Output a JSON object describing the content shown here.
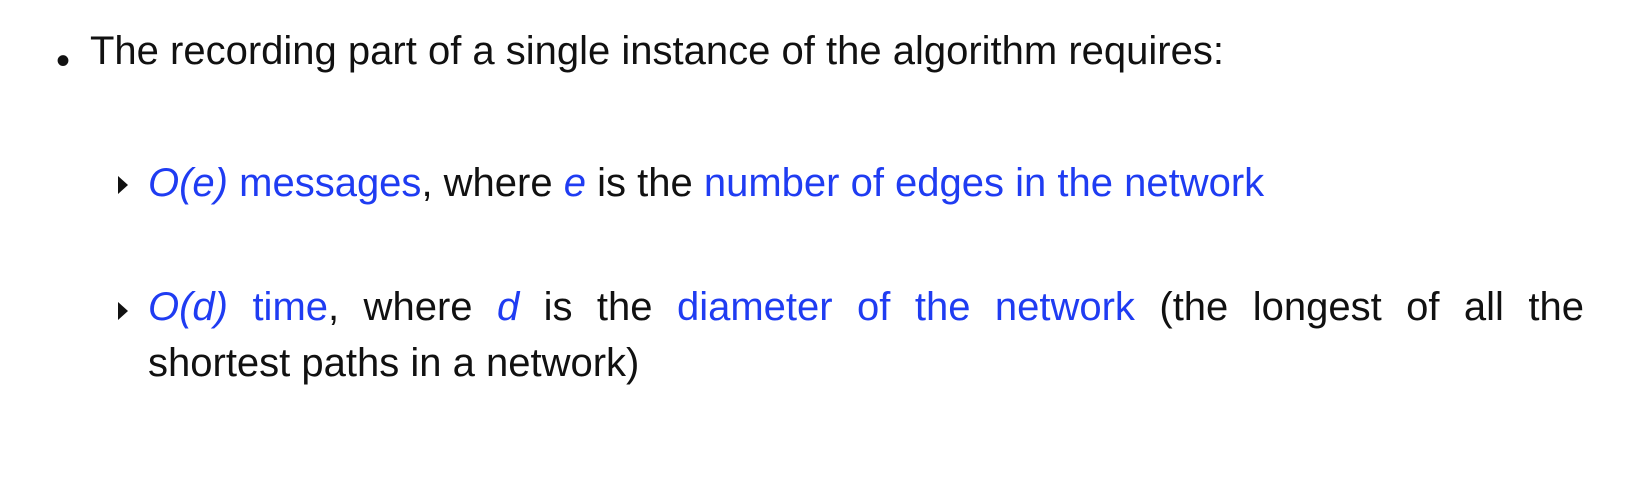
{
  "main_bullet": {
    "marker": "•",
    "text": "The recording part of a single instance of the algorithm requires:"
  },
  "sub_bullets": [
    {
      "complexity": "O(e)",
      "measure": "messages",
      "text_a": ", where ",
      "variable": "e",
      "text_b": " is the ",
      "definition": "number of edges in the network"
    },
    {
      "complexity": "O(d)",
      "measure": "time",
      "text_a": ", where ",
      "variable": "d",
      "text_b": " is the ",
      "definition": "diameter of the network",
      "text_c": " (the longest of all the",
      "continuation": "shortest paths in a network)"
    }
  ],
  "colors": {
    "accent_blue": "#1f3cf2",
    "text_black": "#111111"
  }
}
